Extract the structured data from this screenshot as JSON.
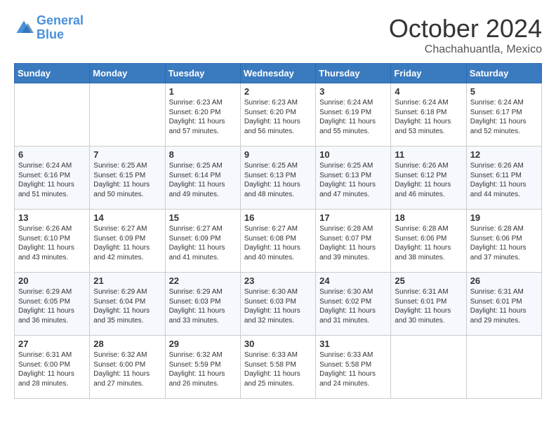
{
  "header": {
    "logo_line1": "General",
    "logo_line2": "Blue",
    "month": "October 2024",
    "location": "Chachahuantla, Mexico"
  },
  "days_of_week": [
    "Sunday",
    "Monday",
    "Tuesday",
    "Wednesday",
    "Thursday",
    "Friday",
    "Saturday"
  ],
  "weeks": [
    [
      {
        "day": "",
        "content": ""
      },
      {
        "day": "",
        "content": ""
      },
      {
        "day": "1",
        "content": "Sunrise: 6:23 AM\nSunset: 6:20 PM\nDaylight: 11 hours and 57 minutes."
      },
      {
        "day": "2",
        "content": "Sunrise: 6:23 AM\nSunset: 6:20 PM\nDaylight: 11 hours and 56 minutes."
      },
      {
        "day": "3",
        "content": "Sunrise: 6:24 AM\nSunset: 6:19 PM\nDaylight: 11 hours and 55 minutes."
      },
      {
        "day": "4",
        "content": "Sunrise: 6:24 AM\nSunset: 6:18 PM\nDaylight: 11 hours and 53 minutes."
      },
      {
        "day": "5",
        "content": "Sunrise: 6:24 AM\nSunset: 6:17 PM\nDaylight: 11 hours and 52 minutes."
      }
    ],
    [
      {
        "day": "6",
        "content": "Sunrise: 6:24 AM\nSunset: 6:16 PM\nDaylight: 11 hours and 51 minutes."
      },
      {
        "day": "7",
        "content": "Sunrise: 6:25 AM\nSunset: 6:15 PM\nDaylight: 11 hours and 50 minutes."
      },
      {
        "day": "8",
        "content": "Sunrise: 6:25 AM\nSunset: 6:14 PM\nDaylight: 11 hours and 49 minutes."
      },
      {
        "day": "9",
        "content": "Sunrise: 6:25 AM\nSunset: 6:13 PM\nDaylight: 11 hours and 48 minutes."
      },
      {
        "day": "10",
        "content": "Sunrise: 6:25 AM\nSunset: 6:13 PM\nDaylight: 11 hours and 47 minutes."
      },
      {
        "day": "11",
        "content": "Sunrise: 6:26 AM\nSunset: 6:12 PM\nDaylight: 11 hours and 46 minutes."
      },
      {
        "day": "12",
        "content": "Sunrise: 6:26 AM\nSunset: 6:11 PM\nDaylight: 11 hours and 44 minutes."
      }
    ],
    [
      {
        "day": "13",
        "content": "Sunrise: 6:26 AM\nSunset: 6:10 PM\nDaylight: 11 hours and 43 minutes."
      },
      {
        "day": "14",
        "content": "Sunrise: 6:27 AM\nSunset: 6:09 PM\nDaylight: 11 hours and 42 minutes."
      },
      {
        "day": "15",
        "content": "Sunrise: 6:27 AM\nSunset: 6:09 PM\nDaylight: 11 hours and 41 minutes."
      },
      {
        "day": "16",
        "content": "Sunrise: 6:27 AM\nSunset: 6:08 PM\nDaylight: 11 hours and 40 minutes."
      },
      {
        "day": "17",
        "content": "Sunrise: 6:28 AM\nSunset: 6:07 PM\nDaylight: 11 hours and 39 minutes."
      },
      {
        "day": "18",
        "content": "Sunrise: 6:28 AM\nSunset: 6:06 PM\nDaylight: 11 hours and 38 minutes."
      },
      {
        "day": "19",
        "content": "Sunrise: 6:28 AM\nSunset: 6:06 PM\nDaylight: 11 hours and 37 minutes."
      }
    ],
    [
      {
        "day": "20",
        "content": "Sunrise: 6:29 AM\nSunset: 6:05 PM\nDaylight: 11 hours and 36 minutes."
      },
      {
        "day": "21",
        "content": "Sunrise: 6:29 AM\nSunset: 6:04 PM\nDaylight: 11 hours and 35 minutes."
      },
      {
        "day": "22",
        "content": "Sunrise: 6:29 AM\nSunset: 6:03 PM\nDaylight: 11 hours and 33 minutes."
      },
      {
        "day": "23",
        "content": "Sunrise: 6:30 AM\nSunset: 6:03 PM\nDaylight: 11 hours and 32 minutes."
      },
      {
        "day": "24",
        "content": "Sunrise: 6:30 AM\nSunset: 6:02 PM\nDaylight: 11 hours and 31 minutes."
      },
      {
        "day": "25",
        "content": "Sunrise: 6:31 AM\nSunset: 6:01 PM\nDaylight: 11 hours and 30 minutes."
      },
      {
        "day": "26",
        "content": "Sunrise: 6:31 AM\nSunset: 6:01 PM\nDaylight: 11 hours and 29 minutes."
      }
    ],
    [
      {
        "day": "27",
        "content": "Sunrise: 6:31 AM\nSunset: 6:00 PM\nDaylight: 11 hours and 28 minutes."
      },
      {
        "day": "28",
        "content": "Sunrise: 6:32 AM\nSunset: 6:00 PM\nDaylight: 11 hours and 27 minutes."
      },
      {
        "day": "29",
        "content": "Sunrise: 6:32 AM\nSunset: 5:59 PM\nDaylight: 11 hours and 26 minutes."
      },
      {
        "day": "30",
        "content": "Sunrise: 6:33 AM\nSunset: 5:58 PM\nDaylight: 11 hours and 25 minutes."
      },
      {
        "day": "31",
        "content": "Sunrise: 6:33 AM\nSunset: 5:58 PM\nDaylight: 11 hours and 24 minutes."
      },
      {
        "day": "",
        "content": ""
      },
      {
        "day": "",
        "content": ""
      }
    ]
  ]
}
